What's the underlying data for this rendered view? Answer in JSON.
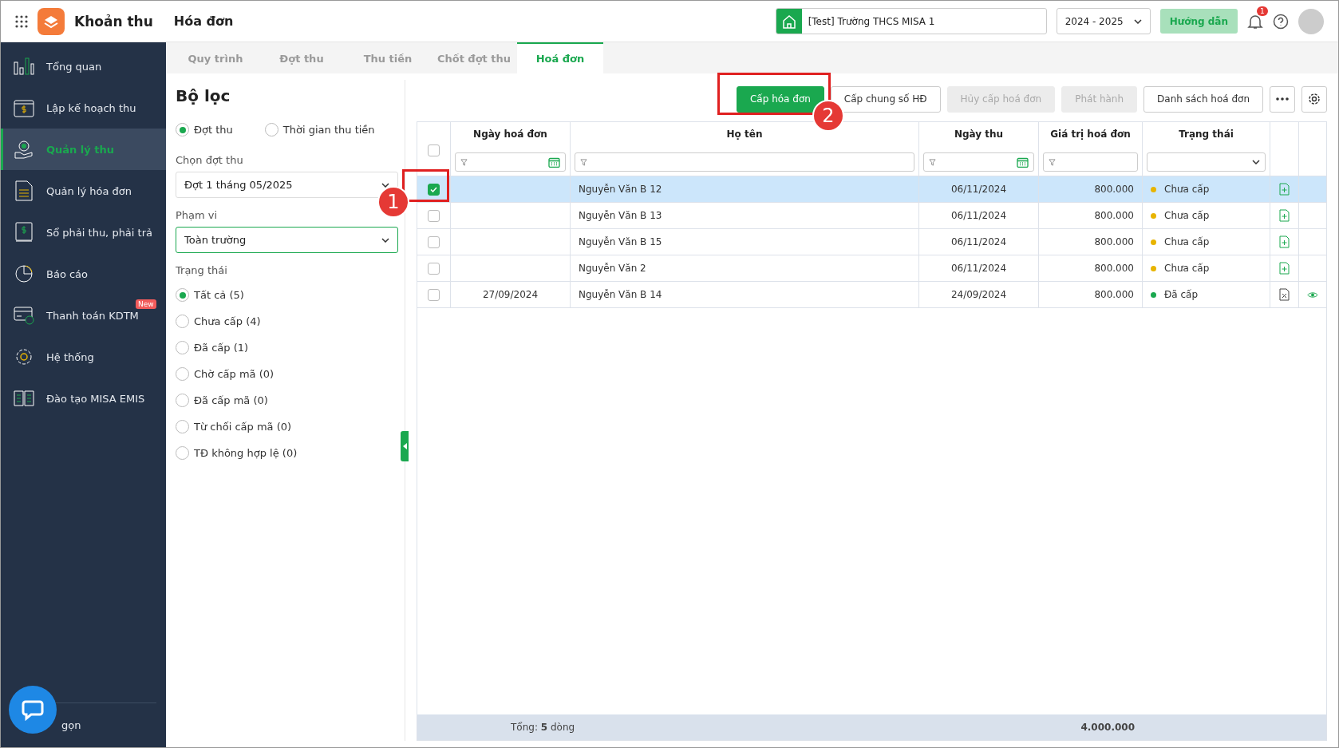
{
  "app": {
    "title": "Khoản thu",
    "page_title": "Hóa đơn"
  },
  "header": {
    "school": "[Test] Trường THCS MISA 1",
    "year": "2024 - 2025",
    "guide_button": "Hướng dẫn",
    "notification_count": "1"
  },
  "sidebar": {
    "items": [
      {
        "label": "Tổng quan",
        "selected": false
      },
      {
        "label": "Lập kế hoạch thu",
        "selected": false
      },
      {
        "label": "Quản lý thu",
        "selected": true
      },
      {
        "label": "Quản lý hóa đơn",
        "selected": false
      },
      {
        "label": "Sổ phải thu, phải trả",
        "selected": false
      },
      {
        "label": "Báo cáo",
        "selected": false
      },
      {
        "label": "Thanh toán KDTM",
        "selected": false,
        "badge": "New"
      },
      {
        "label": "Hệ thống",
        "selected": false
      },
      {
        "label": "Đào tạo MISA EMIS",
        "selected": false
      }
    ],
    "collapse_label": "gọn"
  },
  "tabs": [
    {
      "label": "Quy trình",
      "selected": false
    },
    {
      "label": "Đợt thu",
      "selected": false
    },
    {
      "label": "Thu tiền",
      "selected": false
    },
    {
      "label": "Chốt đợt thu",
      "selected": false
    },
    {
      "label": "Hoá đơn",
      "selected": true
    }
  ],
  "filter": {
    "title": "Bộ lọc",
    "mode_options": [
      {
        "label": "Đợt thu",
        "selected": true
      },
      {
        "label": "Thời gian thu tiền",
        "selected": false
      }
    ],
    "period_label": "Chọn đợt thu",
    "period_value": "Đợt 1 tháng 05/2025",
    "scope_label": "Phạm vi",
    "scope_value": "Toàn trường",
    "status_label": "Trạng thái",
    "status_options": [
      {
        "label": "Tất cả (5)",
        "selected": true
      },
      {
        "label": "Chưa cấp (4)",
        "selected": false
      },
      {
        "label": "Đã cấp (1)",
        "selected": false
      },
      {
        "label": "Chờ cấp mã (0)",
        "selected": false
      },
      {
        "label": "Đã cấp mã (0)",
        "selected": false
      },
      {
        "label": "Từ chối cấp mã (0)",
        "selected": false
      },
      {
        "label": "TĐ không hợp lệ (0)",
        "selected": false
      }
    ]
  },
  "toolbar": {
    "buttons": [
      {
        "label": "Cấp hóa đơn",
        "kind": "primary"
      },
      {
        "label": "Cấp chung số HĐ",
        "kind": "default"
      },
      {
        "label": "Hủy cấp hoá đơn",
        "kind": "disabled"
      },
      {
        "label": "Phát hành",
        "kind": "disabled"
      },
      {
        "label": "Danh sách hoá đơn",
        "kind": "default"
      }
    ]
  },
  "table": {
    "all_selected": false,
    "columns": [
      {
        "label": "Ngày hoá đơn",
        "kind": "date"
      },
      {
        "label": "Họ tên",
        "kind": "text"
      },
      {
        "label": "Ngày thu",
        "kind": "date"
      },
      {
        "label": "Giá trị hoá đơn",
        "kind": "text"
      },
      {
        "label": "Trạng thái",
        "kind": "select"
      }
    ],
    "rows": [
      {
        "selected": true,
        "invoice_date": "",
        "name": "Nguyễn Văn B 12",
        "date": "06/11/2024",
        "value": "800.000",
        "status": "Chưa cấp",
        "color": "#e8b400",
        "issued": false
      },
      {
        "selected": false,
        "invoice_date": "",
        "name": "Nguyễn Văn B 13",
        "date": "06/11/2024",
        "value": "800.000",
        "status": "Chưa cấp",
        "color": "#e8b400",
        "issued": false
      },
      {
        "selected": false,
        "invoice_date": "",
        "name": "Nguyễn Văn B 15",
        "date": "06/11/2024",
        "value": "800.000",
        "status": "Chưa cấp",
        "color": "#e8b400",
        "issued": false
      },
      {
        "selected": false,
        "invoice_date": "",
        "name": "Nguyễn Văn 2",
        "date": "06/11/2024",
        "value": "800.000",
        "status": "Chưa cấp",
        "color": "#e8b400",
        "issued": false
      },
      {
        "selected": false,
        "invoice_date": "27/09/2024",
        "name": "Nguyễn Văn B 14",
        "date": "24/09/2024",
        "value": "800.000",
        "status": "Đã cấp",
        "color": "#1aa84f",
        "issued": true
      }
    ],
    "footer": {
      "total_label": "Tổng: **5** dòng",
      "total_value": "4.000.000"
    }
  },
  "annotations": [
    {
      "number": "1"
    },
    {
      "number": "2"
    }
  ]
}
